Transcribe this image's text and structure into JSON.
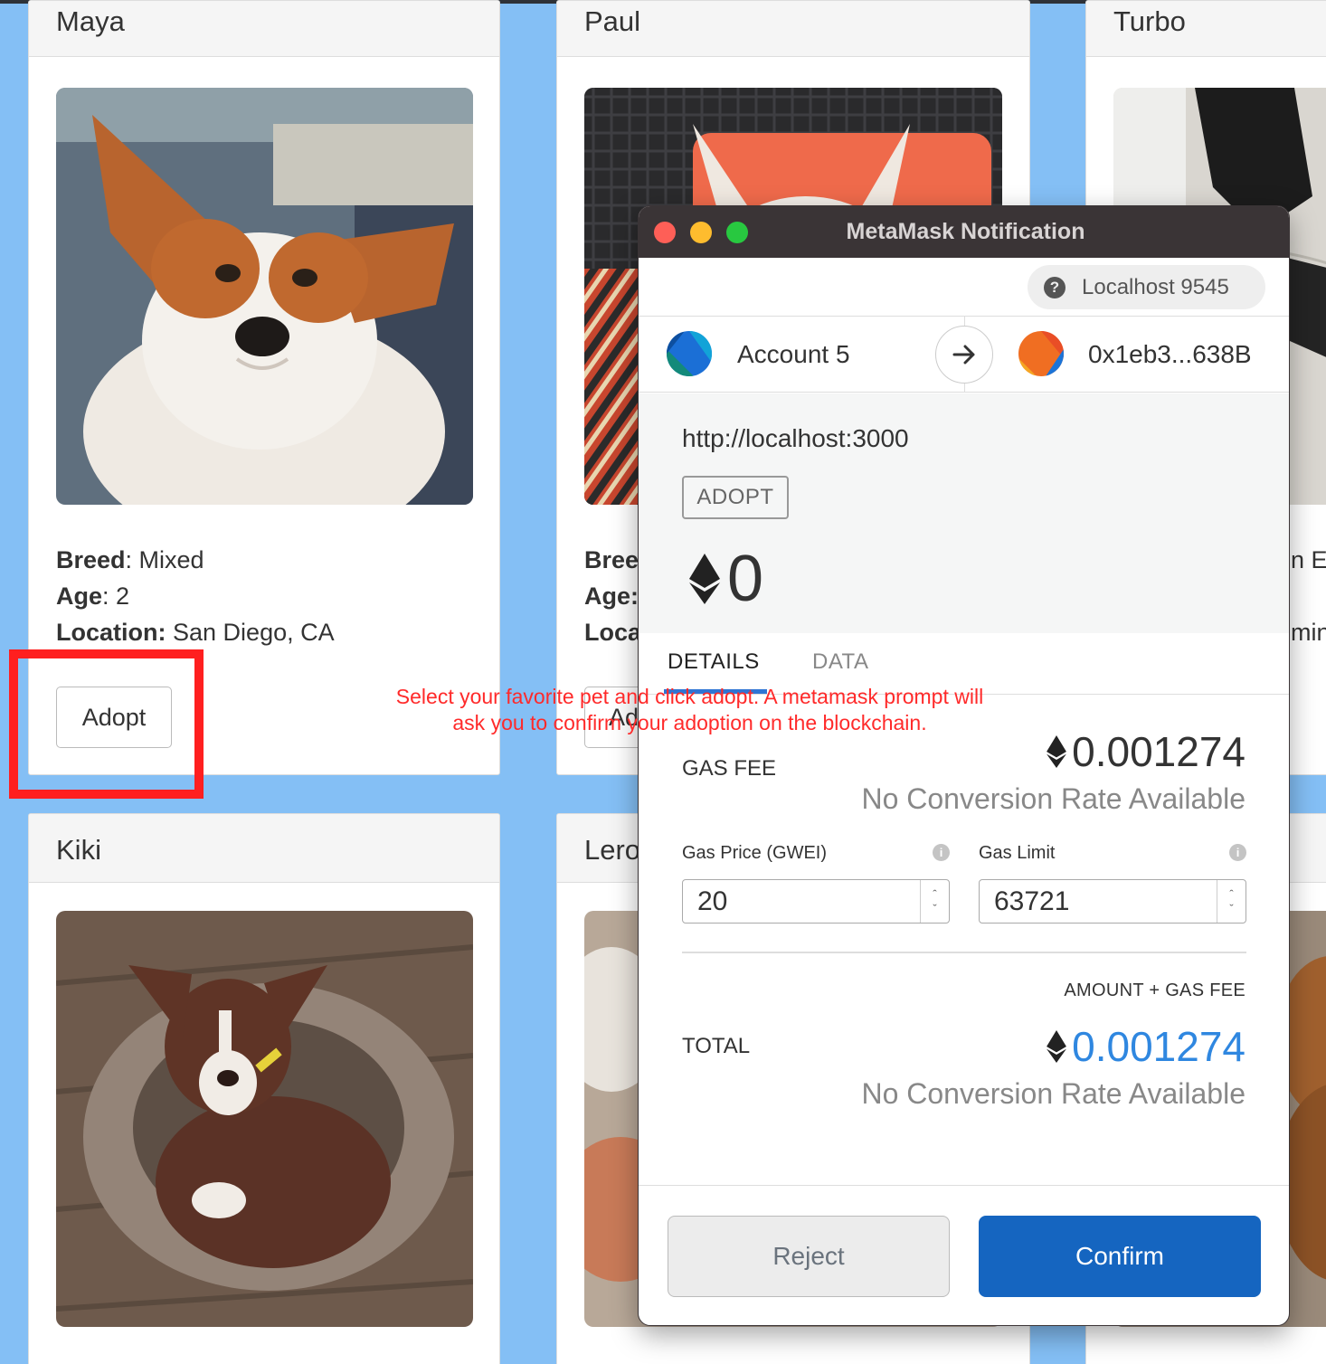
{
  "pets": [
    {
      "name": "Maya",
      "breed_label": "Breed",
      "breed": "Mixed",
      "age_label": "Age",
      "age": "2",
      "location_label": "Location:",
      "location": "San Diego, CA",
      "button": "Adopt"
    },
    {
      "name": "Paul",
      "breed_label": "Bree",
      "age_label": "Age:",
      "location_label": "Loca",
      "button": "Ad"
    },
    {
      "name": "Turbo",
      "breed_tail": "n E",
      "location_tail": "min"
    },
    {
      "name": "Kiki"
    },
    {
      "name": "Lero"
    }
  ],
  "hint": {
    "line1": "Select your favorite pet and click adopt. A metamask prompt will",
    "line2": "ask you to confirm your adoption on the blockchain."
  },
  "metamask": {
    "window_title": "MetaMask Notification",
    "network": "Localhost 9545",
    "from_account": "Account 5",
    "to_address": "0x1eb3...638B",
    "origin": "http://localhost:3000",
    "method": "ADOPT",
    "amount": "0",
    "tabs": [
      "DETAILS",
      "DATA"
    ],
    "active_tab": "DETAILS",
    "gas_fee_label": "GAS FEE",
    "gas_fee": "0.001274",
    "no_conversion": "No Conversion Rate Available",
    "gas_price_label": "Gas Price (GWEI)",
    "gas_price": "20",
    "gas_limit_label": "Gas Limit",
    "gas_limit": "63721",
    "amount_plus_gas_label": "AMOUNT + GAS FEE",
    "total_label": "TOTAL",
    "total": "0.001274",
    "reject_label": "Reject",
    "confirm_label": "Confirm"
  },
  "colors": {
    "page_bg": "#84bff5",
    "highlight": "#ff1f1f",
    "hint_text": "#ff2a2a",
    "confirm_bg": "#1565c0",
    "total_blue": "#2f87e0",
    "tab_underline": "#2f75d4"
  },
  "icons": [
    "help-icon",
    "arrow-right-icon",
    "ethereum-icon",
    "info-icon",
    "spinner-arrows-icon"
  ]
}
